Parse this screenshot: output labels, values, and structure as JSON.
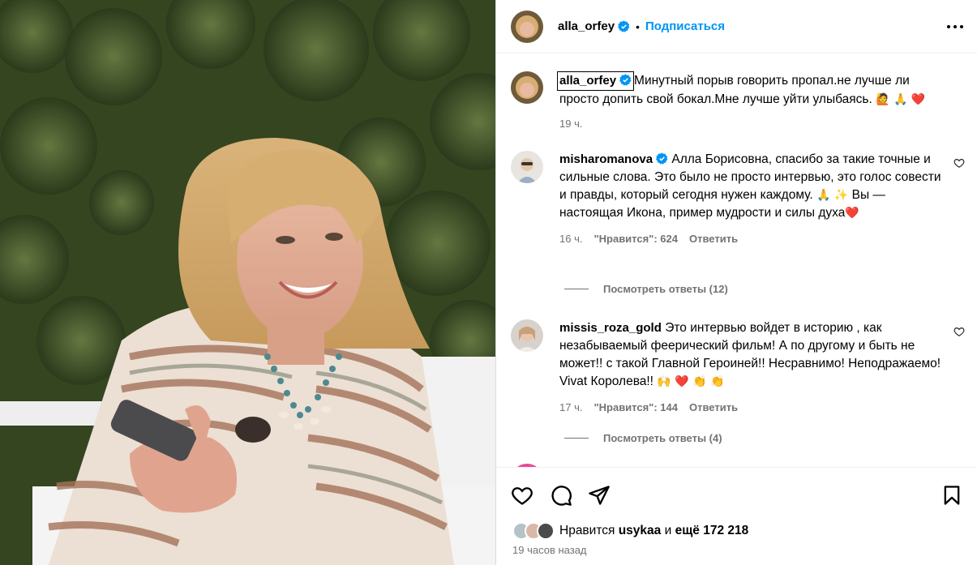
{
  "post": {
    "author": "alla_orfey",
    "follow_label": "Подписаться",
    "dot": "•"
  },
  "caption": {
    "username": "alla_orfey",
    "text": "Минутный порыв говорить пропал.не лучше ли просто допить свой бокал.Мне лучше уйти улыбаясь.",
    "emojis": "🙋 🙏 ❤️",
    "time": "19 ч."
  },
  "comments": [
    {
      "username": "misharomanova",
      "text": "Алла Борисовна, спасибо за такие точные и сильные слова. Это было не просто интервью, это голос совести и правды, который сегодня нужен каждому.",
      "text2_emojis": "🙏 ✨",
      "text2": " Вы — настоящая Икона, пример мудрости и силы духа",
      "text2_end_emoji": "❤️",
      "time": "16 ч.",
      "likes": "\"Нравится\": 624",
      "reply_label": "Ответить",
      "view_replies": "Посмотреть ответы (12)"
    },
    {
      "username": "missis_roza_gold",
      "text": "Это интервью войдет в историю , как незабываемый феерический фильм! А по другому и быть не может!! с такой Главной Героиней!! Несравнимо! Неподражаемо! Vivat Королева!!",
      "text_emojis": "🙌 ❤️ 👏 👏",
      "time": "17 ч.",
      "likes": "\"Нравится\": 144",
      "reply_label": "Ответить",
      "view_replies": "Посмотреть ответы (4)"
    }
  ],
  "likes_summary": {
    "prefix": "Нравится",
    "user": "usykaa",
    "middle": "и",
    "rest": "ещё 172 218"
  },
  "posted_ago": "19 часов назад",
  "icons": {
    "verified": "verified-badge-icon",
    "more": "more-options-icon",
    "like": "heart-icon",
    "comment": "comment-icon",
    "share": "send-icon",
    "save": "bookmark-icon"
  },
  "colors": {
    "link_blue": "#0095f6",
    "verified_blue": "#0095f6",
    "secondary_text": "#737373"
  }
}
